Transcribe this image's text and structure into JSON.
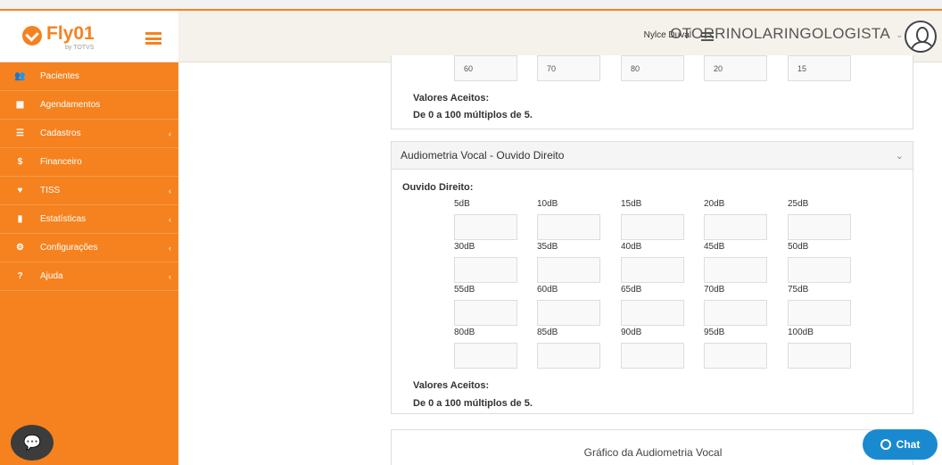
{
  "brand": {
    "name": "Fly01",
    "subtitle": "by TOTVS"
  },
  "sidebar": {
    "items": [
      {
        "label": "Pacientes",
        "icon": "users-icon",
        "glyph": "👥",
        "chev": ""
      },
      {
        "label": "Agendamentos",
        "icon": "calendar-icon",
        "glyph": "▦",
        "chev": ""
      },
      {
        "label": "Cadastros",
        "icon": "list-icon",
        "glyph": "☰",
        "chev": "‹"
      },
      {
        "label": "Financeiro",
        "icon": "dollar-icon",
        "glyph": "$",
        "chev": ""
      },
      {
        "label": "TISS",
        "icon": "heartbeat-icon",
        "glyph": "♥",
        "chev": "‹"
      },
      {
        "label": "Estatísticas",
        "icon": "bar-chart-icon",
        "glyph": "▮",
        "chev": "‹"
      },
      {
        "label": "Configurações",
        "icon": "gear-icon",
        "glyph": "⚙",
        "chev": "‹"
      },
      {
        "label": "Ajuda",
        "icon": "question-icon",
        "glyph": "?",
        "chev": "‹"
      }
    ]
  },
  "header": {
    "user": "Nylce Duval",
    "specialty": "OTORRINOLARINGOLOGISTA",
    "chevron": "⌄"
  },
  "panel_top": {
    "values": [
      "60",
      "70",
      "80",
      "20",
      "15"
    ],
    "accepted_title": "Valores Aceitos:",
    "accepted_text": "De 0 a 100 múltiplos de 5."
  },
  "panel_right": {
    "title": "Audiometria Vocal - Ouvido Direito",
    "collapse": "⌄",
    "ear_label": "Ouvido Direito:",
    "db_labels": [
      "5dB",
      "10dB",
      "15dB",
      "20dB",
      "25dB",
      "30dB",
      "35dB",
      "40dB",
      "45dB",
      "50dB",
      "55dB",
      "60dB",
      "65dB",
      "70dB",
      "75dB",
      "80dB",
      "85dB",
      "90dB",
      "95dB",
      "100dB"
    ],
    "accepted_title": "Valores Aceitos:",
    "accepted_text": "De 0 a 100 múltiplos de 5."
  },
  "panel_chart": {
    "title": "Gráfico da Audiometria Vocal"
  },
  "chat": {
    "label": "Chat"
  }
}
